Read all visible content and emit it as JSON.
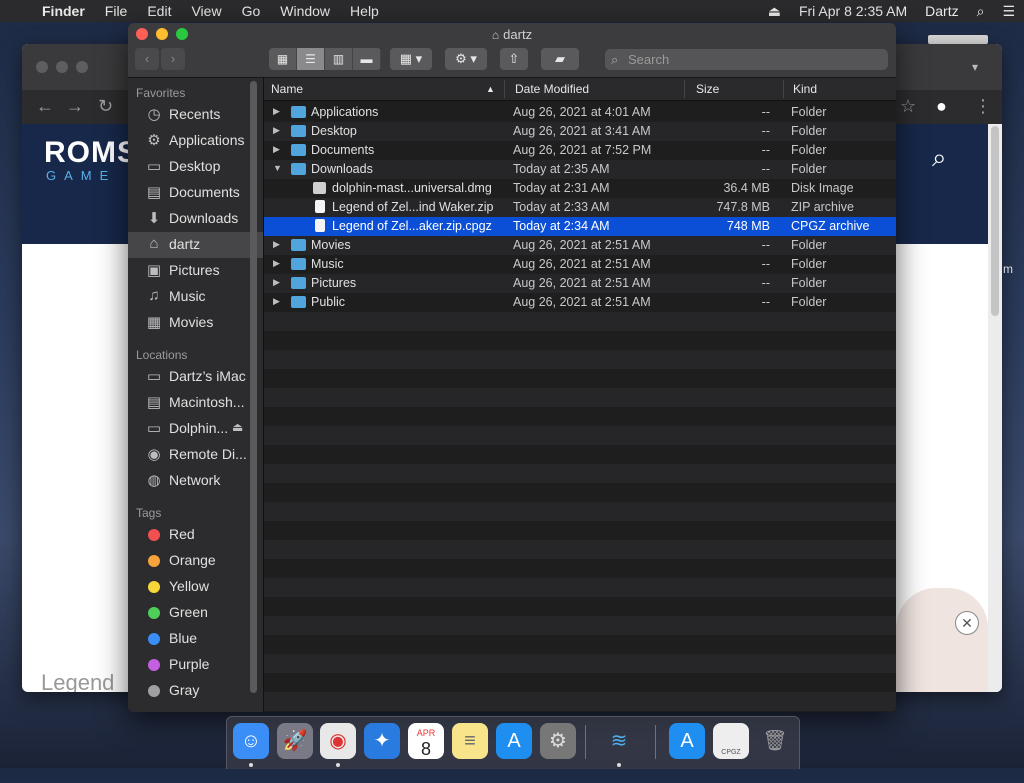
{
  "menubar": {
    "apple": "",
    "app": "Finder",
    "menus": [
      "File",
      "Edit",
      "View",
      "Go",
      "Window",
      "Help"
    ],
    "datetime": "Fri Apr 8  2:35 AM",
    "user": "Dartz"
  },
  "browser": {
    "logo": "ROMS",
    "logo_sub": "GAME",
    "legend_text": "Legend",
    "peek_text": "m"
  },
  "finder": {
    "title": "dartz",
    "search_placeholder": "Search",
    "sidebar": {
      "favorites_header": "Favorites",
      "favorites": [
        {
          "label": "Recents",
          "icon": "clock-icon"
        },
        {
          "label": "Applications",
          "icon": "applications-icon"
        },
        {
          "label": "Desktop",
          "icon": "desktop-icon"
        },
        {
          "label": "Documents",
          "icon": "document-icon"
        },
        {
          "label": "Downloads",
          "icon": "download-icon"
        },
        {
          "label": "dartz",
          "icon": "home-icon"
        },
        {
          "label": "Pictures",
          "icon": "camera-icon"
        },
        {
          "label": "Music",
          "icon": "music-icon"
        },
        {
          "label": "Movies",
          "icon": "film-icon"
        }
      ],
      "locations_header": "Locations",
      "locations": [
        {
          "label": "Dartz’s iMac",
          "icon": "computer-icon"
        },
        {
          "label": "Macintosh...",
          "icon": "disk-icon"
        },
        {
          "label": "Dolphin...",
          "icon": "disk-icon"
        },
        {
          "label": "Remote Di...",
          "icon": "optical-disc-icon"
        },
        {
          "label": "Network",
          "icon": "globe-icon"
        }
      ],
      "tags_header": "Tags",
      "tags": [
        {
          "label": "Red",
          "color": "#f0504f"
        },
        {
          "label": "Orange",
          "color": "#f5a33a"
        },
        {
          "label": "Yellow",
          "color": "#f5d73a"
        },
        {
          "label": "Green",
          "color": "#4fcf5a"
        },
        {
          "label": "Blue",
          "color": "#3a8ef5"
        },
        {
          "label": "Purple",
          "color": "#c35fe0"
        },
        {
          "label": "Gray",
          "color": "#a0a0a2"
        }
      ]
    },
    "columns": {
      "name": "Name",
      "date": "Date Modified",
      "size": "Size",
      "kind": "Kind"
    },
    "rows": [
      {
        "name": "Applications",
        "date": "Aug 26, 2021 at 4:01 AM",
        "size": "--",
        "kind": "Folder"
      },
      {
        "name": "Desktop",
        "date": "Aug 26, 2021 at 3:41 AM",
        "size": "--",
        "kind": "Folder"
      },
      {
        "name": "Documents",
        "date": "Aug 26, 2021 at 7:52 PM",
        "size": "--",
        "kind": "Folder"
      },
      {
        "name": "Downloads",
        "date": "Today at 2:35 AM",
        "size": "--",
        "kind": "Folder"
      },
      {
        "name": "dolphin-mast...universal.dmg",
        "date": "Today at 2:31 AM",
        "size": "36.4 MB",
        "kind": "Disk Image"
      },
      {
        "name": "Legend of Zel...ind Waker.zip",
        "date": "Today at 2:33 AM",
        "size": "747.8 MB",
        "kind": "ZIP archive"
      },
      {
        "name": "Legend of Zel...aker.zip.cpgz",
        "date": "Today at 2:34 AM",
        "size": "748 MB",
        "kind": "CPGZ archive"
      },
      {
        "name": "Movies",
        "date": "Aug 26, 2021 at 2:51 AM",
        "size": "--",
        "kind": "Folder"
      },
      {
        "name": "Music",
        "date": "Aug 26, 2021 at 2:51 AM",
        "size": "--",
        "kind": "Folder"
      },
      {
        "name": "Pictures",
        "date": "Aug 26, 2021 at 2:51 AM",
        "size": "--",
        "kind": "Folder"
      },
      {
        "name": "Public",
        "date": "Aug 26, 2021 at 2:51 AM",
        "size": "--",
        "kind": "Folder"
      }
    ]
  },
  "dock": {
    "items": [
      "finder-icon",
      "launchpad-icon",
      "chrome-icon",
      "safari-icon",
      "calendar-icon",
      "notes-icon",
      "app-store-icon",
      "system-preferences-icon",
      "dolphin-icon",
      "app-store-icon",
      "archive-icon",
      "trash-icon"
    ],
    "calendar_day": "8",
    "calendar_month": "APR",
    "archive_label": "CPGZ"
  }
}
